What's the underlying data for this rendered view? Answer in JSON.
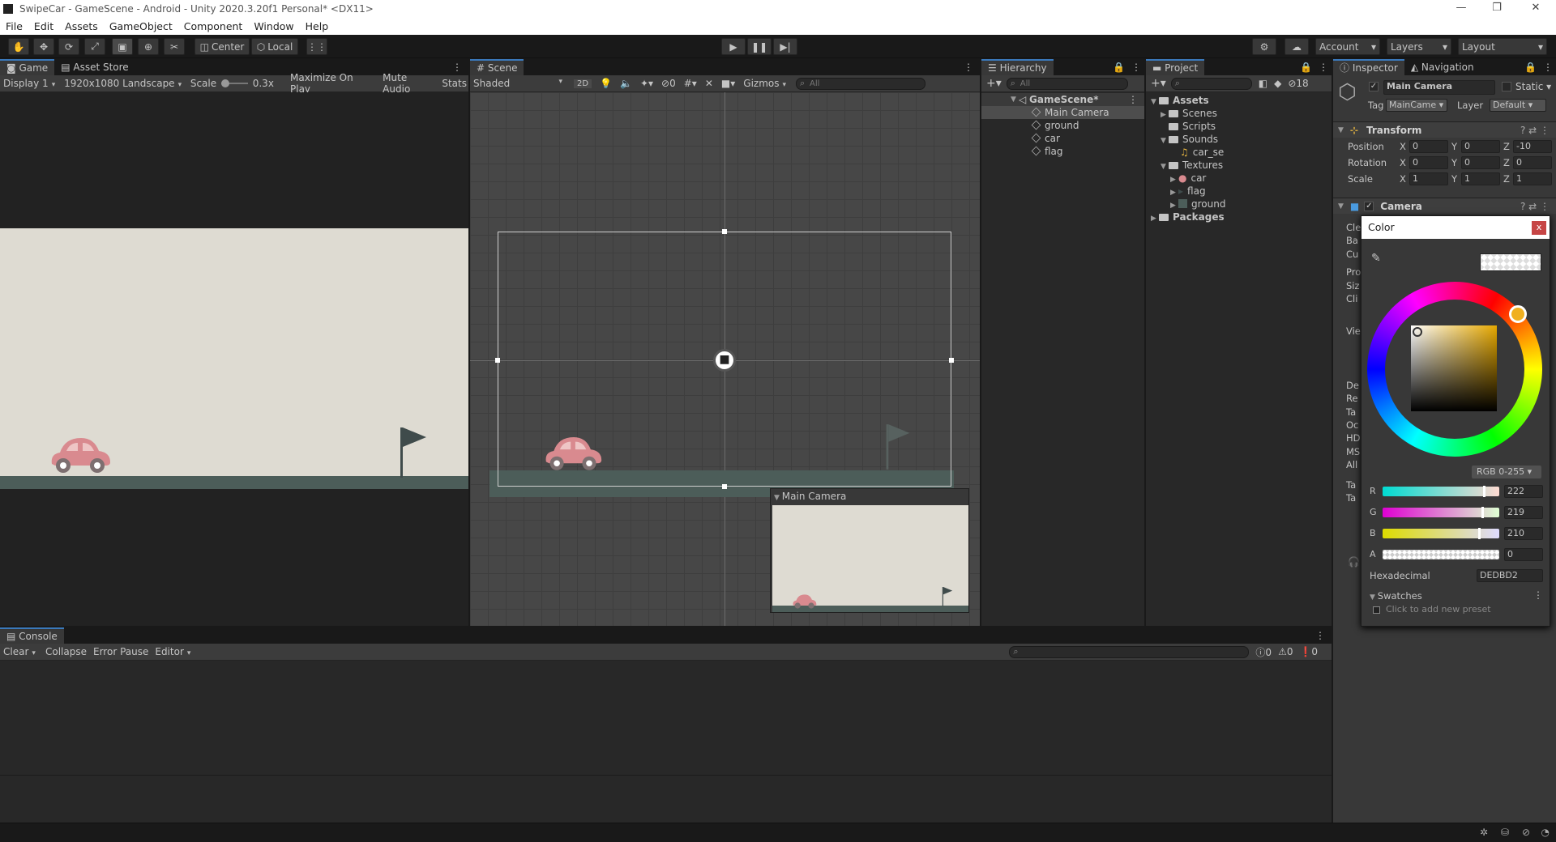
{
  "window": {
    "title": "SwipeCar - GameScene - Android - Unity 2020.3.20f1 Personal* <DX11>",
    "minimize": "—",
    "maximize": "❐",
    "close": "✕"
  },
  "menu": [
    "File",
    "Edit",
    "Assets",
    "GameObject",
    "Component",
    "Window",
    "Help"
  ],
  "toolbar": {
    "center": "Center",
    "local": "Local",
    "account": "Account",
    "layers": "Layers",
    "layout": "Layout"
  },
  "game": {
    "tab_game": "Game",
    "tab_store": "Asset Store",
    "display": "Display 1",
    "resolution": "1920x1080 Landscape",
    "scale_label": "Scale",
    "scale_value": "0.3x",
    "maximize": "Maximize On Play",
    "mute": "Mute Audio",
    "stats": "Stats"
  },
  "scene": {
    "tab": "Scene",
    "shading": "Shaded",
    "mode2d": "2D",
    "hidden_count": "0",
    "gizmos": "Gizmos",
    "search": "All",
    "preview_title": "Main Camera"
  },
  "hierarchy": {
    "tab": "Hierarchy",
    "search": "All",
    "scene_name": "GameScene*",
    "items": [
      "Main Camera",
      "ground",
      "car",
      "flag"
    ]
  },
  "project": {
    "tab": "Project",
    "count": "18",
    "assets": "Assets",
    "scenes": "Scenes",
    "scripts": "Scripts",
    "sounds": "Sounds",
    "sound_file": "car_se",
    "textures": "Textures",
    "tex_car": "car",
    "tex_flag": "flag",
    "tex_ground": "ground",
    "packages": "Packages"
  },
  "inspector": {
    "tab_inspector": "Inspector",
    "tab_navigation": "Navigation",
    "object_name": "Main Camera",
    "static": "Static",
    "tag_label": "Tag",
    "tag_value": "MainCame",
    "layer_label": "Layer",
    "layer_value": "Default",
    "transform": "Transform",
    "position": {
      "label": "Position",
      "x": "0",
      "y": "0",
      "z": "-10"
    },
    "rotation": {
      "label": "Rotation",
      "x": "0",
      "y": "0",
      "z": "0"
    },
    "scale": {
      "label": "Scale",
      "x": "1",
      "y": "1",
      "z": "1"
    },
    "axis_x": "X",
    "axis_y": "Y",
    "axis_z": "Z",
    "camera": "Camera",
    "left_labels": [
      "Cle",
      "Ba",
      "Cu",
      "Pro",
      "Siz",
      "Cli",
      "Vie",
      "De",
      "Re",
      "Ta",
      "Oc",
      "HD",
      "MS",
      "All",
      "Ta",
      "Ta"
    ]
  },
  "color_picker": {
    "title": "Color",
    "close": "x",
    "mode": "RGB 0-255",
    "r_label": "R",
    "r": "222",
    "g_label": "G",
    "g": "219",
    "b_label": "B",
    "b": "210",
    "a_label": "A",
    "a": "0",
    "hex_label": "Hexadecimal",
    "hex": "DEDBD2",
    "swatches": "Swatches",
    "preset_hint": "Click to add new preset",
    "colors": {
      "bg": "#DEDBD2"
    }
  },
  "console": {
    "tab": "Console",
    "clear": "Clear",
    "collapse": "Collapse",
    "error_pause": "Error Pause",
    "editor": "Editor",
    "c_log": "0",
    "c_warn": "0",
    "c_err": "0"
  }
}
